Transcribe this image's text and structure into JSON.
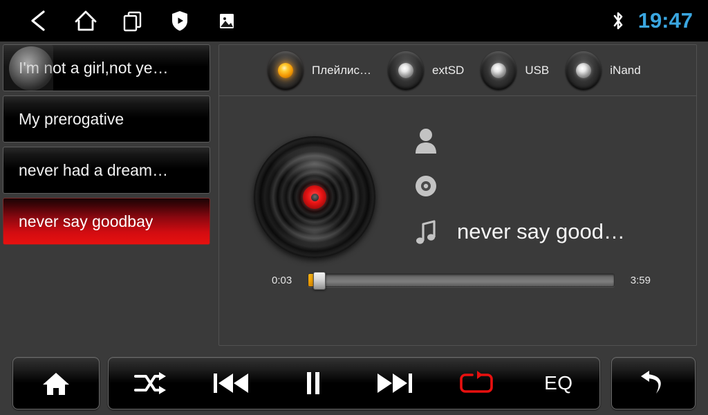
{
  "statusbar": {
    "nav": [
      {
        "name": "back-icon",
        "label": "Back"
      },
      {
        "name": "home-icon",
        "label": "Home"
      },
      {
        "name": "recents-icon",
        "label": "Recent apps"
      },
      {
        "name": "shield-play-icon",
        "label": "Protected player"
      },
      {
        "name": "gallery-icon",
        "label": "Gallery"
      }
    ],
    "bluetooth_icon": "bluetooth-icon",
    "clock": "19:47",
    "clock_color": "#3aa6e0"
  },
  "playlist": {
    "items": [
      {
        "title": "I'm not a girl,not ye…",
        "selected": false,
        "pressed": true
      },
      {
        "title": "My prerogative",
        "selected": false,
        "pressed": false
      },
      {
        "title": "never had a dream…",
        "selected": false,
        "pressed": false
      },
      {
        "title": "never say goodbay",
        "selected": true,
        "pressed": false
      }
    ],
    "selected_color": "#d20c11"
  },
  "sources": {
    "tabs": [
      {
        "label": "Плейлис…",
        "active": true
      },
      {
        "label": "extSD",
        "active": false
      },
      {
        "label": "USB",
        "active": false
      },
      {
        "label": "iNand",
        "active": false
      }
    ],
    "active_led_color": "#f5a607"
  },
  "nowplaying": {
    "album_art": "vinyl-disc",
    "artist": "",
    "album": "",
    "title": "never say good…",
    "artist_icon": "person-icon",
    "album_icon": "disc-icon",
    "title_icon": "music-note-icon"
  },
  "progress": {
    "elapsed": "0:03",
    "duration": "3:59",
    "percent": 2.2,
    "fill_color": "#f5a607"
  },
  "controls": {
    "home": {
      "label": "Home",
      "icon": "home-icon"
    },
    "shuffle": {
      "label": "Shuffle",
      "icon": "shuffle-icon",
      "active": false
    },
    "previous": {
      "label": "Previous",
      "icon": "previous-icon"
    },
    "playpause": {
      "label": "Pause",
      "icon": "pause-icon"
    },
    "next": {
      "label": "Next",
      "icon": "next-icon"
    },
    "repeat": {
      "label": "Repeat",
      "icon": "repeat-icon",
      "active": true,
      "active_color": "#e8100f"
    },
    "eq": {
      "label": "EQ",
      "icon": "equalizer-label"
    },
    "back": {
      "label": "Back",
      "icon": "return-arrow-icon"
    }
  }
}
